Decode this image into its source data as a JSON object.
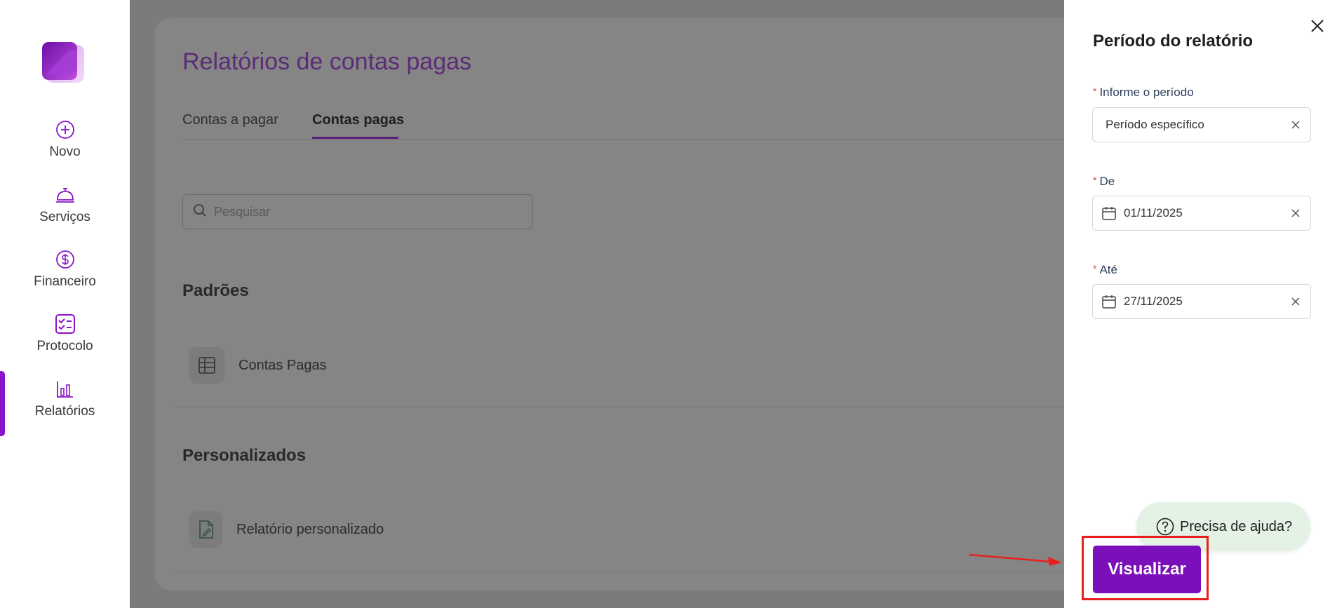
{
  "sidebar": {
    "items": [
      {
        "label": "Novo",
        "icon": "plus-circle-icon"
      },
      {
        "label": "Serviços",
        "icon": "service-bell-icon"
      },
      {
        "label": "Financeiro",
        "icon": "dollar-circle-icon"
      },
      {
        "label": "Protocolo",
        "icon": "checklist-icon"
      },
      {
        "label": "Relatórios",
        "icon": "bar-chart-icon",
        "active": true
      }
    ]
  },
  "main": {
    "title": "Relatórios de contas pagas",
    "tabs": [
      {
        "label": "Contas a pagar"
      },
      {
        "label": "Contas pagas",
        "active": true
      }
    ],
    "search": {
      "placeholder": "Pesquisar"
    },
    "sections": [
      {
        "title": "Padrões",
        "items": [
          {
            "label": "Contas Pagas",
            "icon": "table-icon"
          }
        ]
      },
      {
        "title": "Personalizados",
        "items": [
          {
            "label": "Relatório personalizado",
            "icon": "file-edit-icon"
          }
        ]
      }
    ]
  },
  "drawer": {
    "title": "Período do relatório",
    "fields": [
      {
        "label": "Informe o período",
        "required": true,
        "value": "Período específico"
      },
      {
        "label": "De",
        "required": true,
        "value": "01/11/2025",
        "icon": "calendar-icon"
      },
      {
        "label": "Até",
        "required": true,
        "value": "27/11/2025",
        "icon": "calendar-icon"
      }
    ],
    "required_mark": "*",
    "help_label": "Precisa de ajuda?",
    "submit_label": "Visualizar"
  },
  "colors": {
    "brand_purple": "#7b0fb9",
    "overlay_gray": "#7b7b7b",
    "help_green": "#e3f2e5",
    "highlight_red": "#e8201d"
  }
}
